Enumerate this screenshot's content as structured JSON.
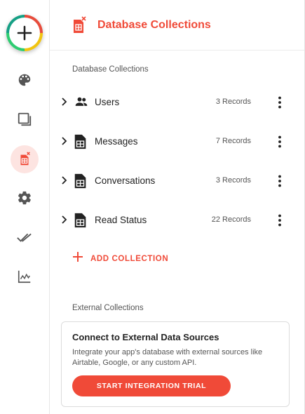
{
  "rail": {
    "items": [
      {
        "name": "palette-icon"
      },
      {
        "name": "window-icon"
      },
      {
        "name": "database-icon",
        "active": true
      },
      {
        "name": "gear-icon"
      },
      {
        "name": "double-check-icon"
      },
      {
        "name": "analytics-icon"
      }
    ]
  },
  "header": {
    "title": "Database Collections"
  },
  "database_section": {
    "label": "Database Collections"
  },
  "collections": [
    {
      "name": "Users",
      "count": "3 Records",
      "icon": "users-icon"
    },
    {
      "name": "Messages",
      "count": "7 Records",
      "icon": "table-icon"
    },
    {
      "name": "Conversations",
      "count": "3 Records",
      "icon": "table-icon"
    },
    {
      "name": "Read Status",
      "count": "22 Records",
      "icon": "table-icon"
    }
  ],
  "add_collection": {
    "label": "ADD COLLECTION"
  },
  "external_section": {
    "label": "External Collections"
  },
  "external_card": {
    "title": "Connect to External Data Sources",
    "description": "Integrate your app's database with external sources like Airtable, Google, or any custom API.",
    "button": "START INTEGRATION TRIAL"
  },
  "colors": {
    "accent": "#f04a38",
    "active_bg": "#fde4e1"
  }
}
